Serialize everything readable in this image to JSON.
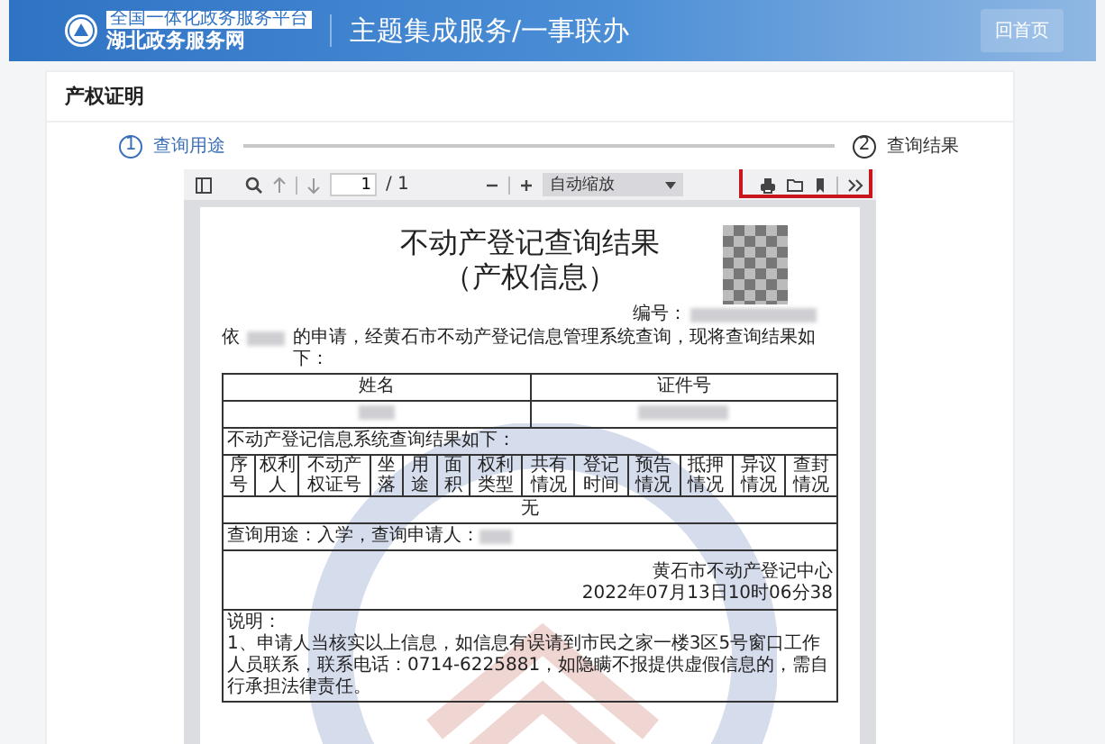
{
  "header": {
    "platform_tagline": "全国一体化政务服务平台",
    "site_name": "湖北政务服务网",
    "page_title": "主题集成服务/一事联办",
    "home_button": "回首页"
  },
  "card": {
    "title": "产权证明"
  },
  "steps": [
    {
      "number": "1",
      "label": "查询用途",
      "selected": true
    },
    {
      "number": "2",
      "label": "查询结果",
      "selected": false
    }
  ],
  "viewer": {
    "page_value": "1",
    "page_total": "/ 1",
    "zoom": "自动缩放",
    "toolbar_highlighted": true
  },
  "document": {
    "title": "不动产登记查询结果",
    "subtitle": "（产权信息）",
    "number_label": "编号：",
    "intro_prefix": "依",
    "intro_text": "的申请，经黄石市不动产登记信息管理系统查询，现将查询结果如下：",
    "person_columns": [
      "姓名",
      "证件号"
    ],
    "result_caption": "不动产登记信息系统查询结果如下：",
    "columns": [
      "序号",
      "权利人",
      "不动产权证号",
      "坐落",
      "用途",
      "面积",
      "权利类型",
      "共有情况",
      "登记时间",
      "预告情况",
      "抵押情况",
      "异议情况",
      "查封情况"
    ],
    "empty_row": "无",
    "purpose_label": "查询用途：",
    "purpose": "入学",
    "applicant_label": "，查询申请人：",
    "issuer": "黄石市不动产登记中心",
    "timestamp": "2022年07月13日10时06分38",
    "notes_title": "说明：",
    "notes": [
      "1、申请人当核实以上信息，如信息有误请到市民之家一楼3区5号窗口工作人员联系，联系电话：0714-6225881，如隐瞒不报提供虚假信息的，需自行承担法律责任。"
    ]
  }
}
